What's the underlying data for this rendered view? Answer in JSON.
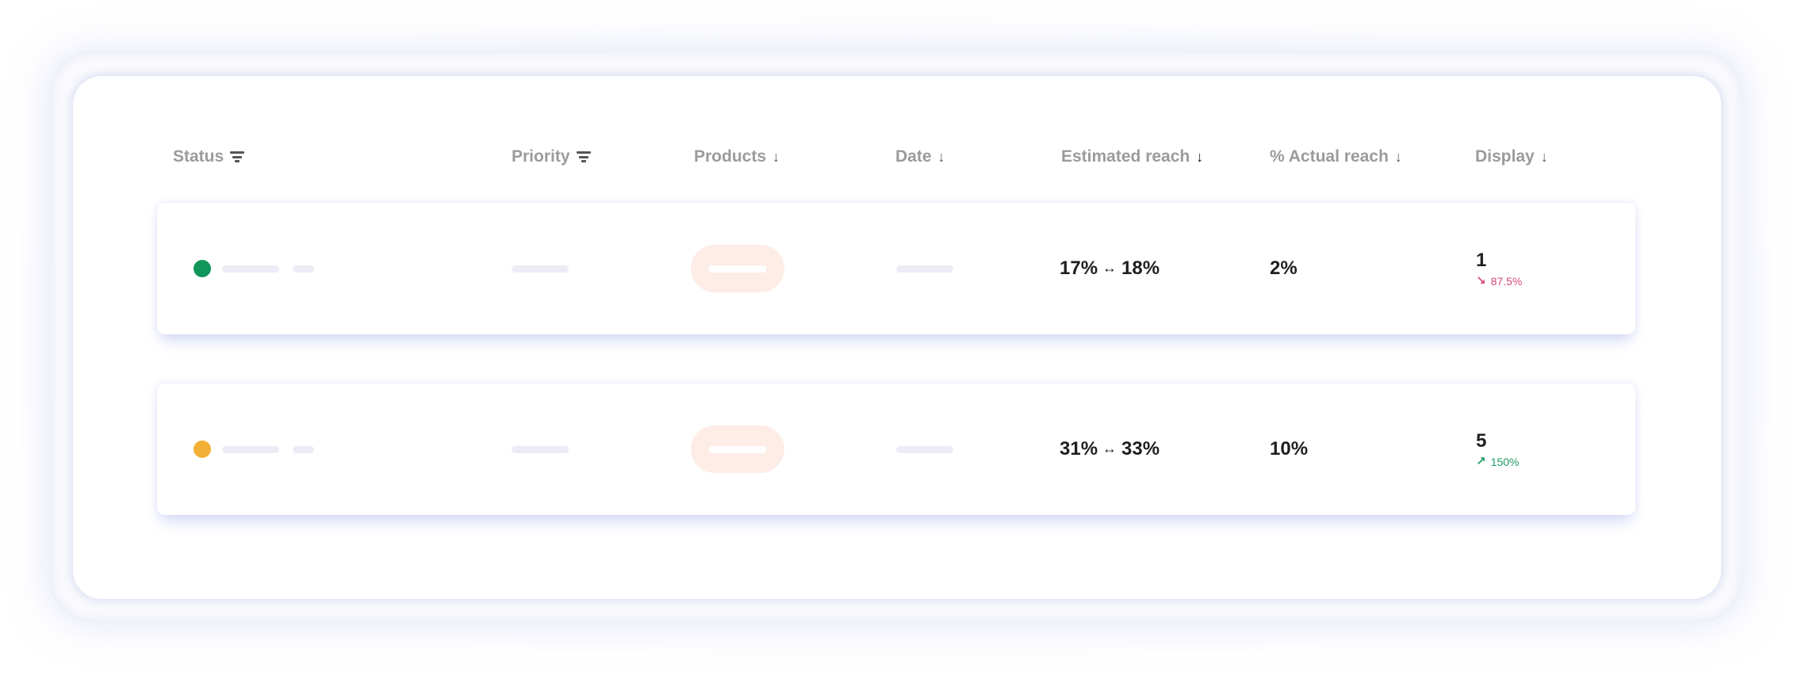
{
  "colors": {
    "status_green": "#12955a",
    "status_amber": "#f2b036",
    "delta_down": "#d84a72",
    "delta_up": "#1f9a63",
    "header_text": "#9b9b9b",
    "product_pill": "#fdede6"
  },
  "table": {
    "columns": [
      {
        "key": "status",
        "label": "Status",
        "icon": "filter-icon",
        "active": false
      },
      {
        "key": "priority",
        "label": "Priority",
        "icon": "filter-icon",
        "active": false
      },
      {
        "key": "products",
        "label": "Products",
        "icon": "arrow-down-icon",
        "active": false
      },
      {
        "key": "date",
        "label": "Date",
        "icon": "arrow-down-icon",
        "active": false
      },
      {
        "key": "estimated_reach",
        "label": "Estimated reach",
        "icon": "arrow-down-icon",
        "active": true
      },
      {
        "key": "actual_reach",
        "label": "% Actual reach",
        "icon": "arrow-down-icon",
        "active": false
      },
      {
        "key": "display",
        "label": "Display",
        "icon": "arrow-down-icon",
        "active": false
      }
    ],
    "arrow_glyph": "↓",
    "range_separator": "↔",
    "rows": [
      {
        "status": "green",
        "est_min": "17%",
        "est_max": "18%",
        "actual": "2%",
        "display": "1",
        "delta_direction": "down",
        "delta_icon": "↘",
        "delta": "87.5%"
      },
      {
        "status": "amber",
        "est_min": "31%",
        "est_max": "33%",
        "actual": "10%",
        "display": "5",
        "delta_direction": "up",
        "delta_icon": "↗",
        "delta": "150%"
      }
    ]
  }
}
